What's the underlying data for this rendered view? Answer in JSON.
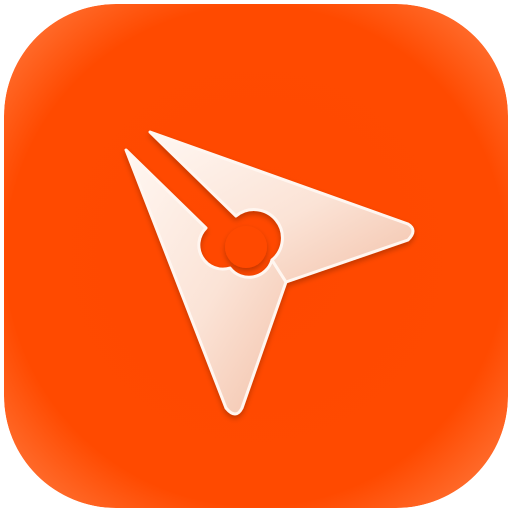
{
  "app_icon": {
    "name": "pen-nib-app-icon",
    "glyph": "pen-nib-cursor-icon"
  },
  "colors": {
    "background": "#FF4A00",
    "background_edge": "#FF6A2A",
    "glyph_light": "#FFF4EE",
    "glyph_shade": "#F7C8B2"
  }
}
